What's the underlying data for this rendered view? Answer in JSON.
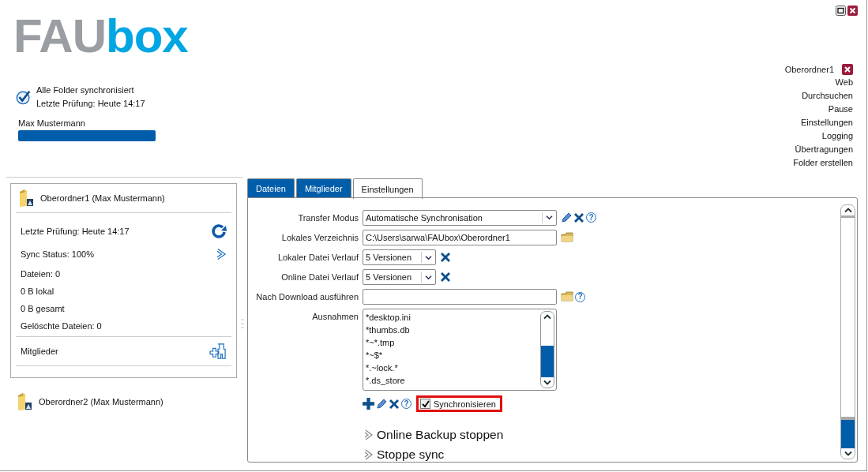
{
  "logo": {
    "part1": "FAU",
    "part2": "box"
  },
  "status": {
    "line1": "Alle Folder synchronisiert",
    "line2": "Letzte Prüfung: Heute 14:17"
  },
  "user": {
    "name": "Max Mustermann",
    "quota": {
      "level": 1
    }
  },
  "menu": {
    "folder": "Oberordner1",
    "items": [
      "Web",
      "Durchsuchen",
      "Pause",
      "Einstellungen",
      "Logging",
      "Übertragungen",
      "Folder erstellen"
    ]
  },
  "folders": [
    {
      "name": "Oberordner1 (Max Mustermann)",
      "expanded": true,
      "details": [
        {
          "kind": "refresh",
          "text": "Letzte Prüfung: Heute 14:17"
        },
        {
          "kind": "open",
          "text": "Sync Status: 100%"
        },
        {
          "kind": "plain",
          "text": "Dateien: 0"
        },
        {
          "kind": "plain",
          "text": "0 B lokal"
        },
        {
          "kind": "plain",
          "text": "0 B gesamt"
        },
        {
          "kind": "plain",
          "text": "Gelöschte Dateien: 0"
        }
      ],
      "members": "Mitglieder"
    },
    {
      "name": "Oberordner2 (Max Mustermann)",
      "expanded": false
    }
  ],
  "tabs": [
    {
      "label": "Dateien",
      "selected": false
    },
    {
      "label": "Mitglieder",
      "selected": false
    },
    {
      "label": "Einstellungen",
      "selected": true
    }
  ],
  "settings": {
    "rows": [
      {
        "label": "Transfer Modus",
        "kind": "combo",
        "value": "Automatische Synchronisation",
        "actions": [
          {
            "kind": "edit"
          },
          {
            "kind": "delete"
          },
          {
            "kind": "help",
            "text": "?"
          }
        ]
      },
      {
        "label": "Lokales Verzeichnis",
        "kind": "text",
        "value": "C:\\Users\\sarwa\\FAUbox\\Oberordner1",
        "actions": [
          {
            "kind": "folder"
          }
        ]
      },
      {
        "label": "Lokaler Datei Verlauf",
        "kind": "select",
        "value": "5 Versionen",
        "actions": [
          {
            "kind": "delete"
          }
        ]
      },
      {
        "label": "Online Datei Verlauf",
        "kind": "select",
        "value": "5 Versionen",
        "actions": [
          {
            "kind": "delete"
          }
        ]
      },
      {
        "label": "Nach Download ausführen",
        "kind": "text",
        "actions": [
          {
            "kind": "folder"
          },
          {
            "kind": "help",
            "text": "?"
          }
        ]
      }
    ],
    "exclusions": {
      "label": "Ausnahmen",
      "items": [
        "*desktop.ini",
        "*thumbs.db",
        "*~*.tmp",
        "*~$*",
        "*.~lock.*",
        "*.ds_store"
      ],
      "actions": [
        {
          "kind": "add"
        },
        {
          "kind": "edit"
        },
        {
          "kind": "delete"
        },
        {
          "kind": "help",
          "text": "?"
        }
      ],
      "sync": {
        "label": "Synchronisieren",
        "checked": true
      }
    },
    "links": [
      "Online Backup stoppen",
      "Stoppe sync"
    ]
  }
}
